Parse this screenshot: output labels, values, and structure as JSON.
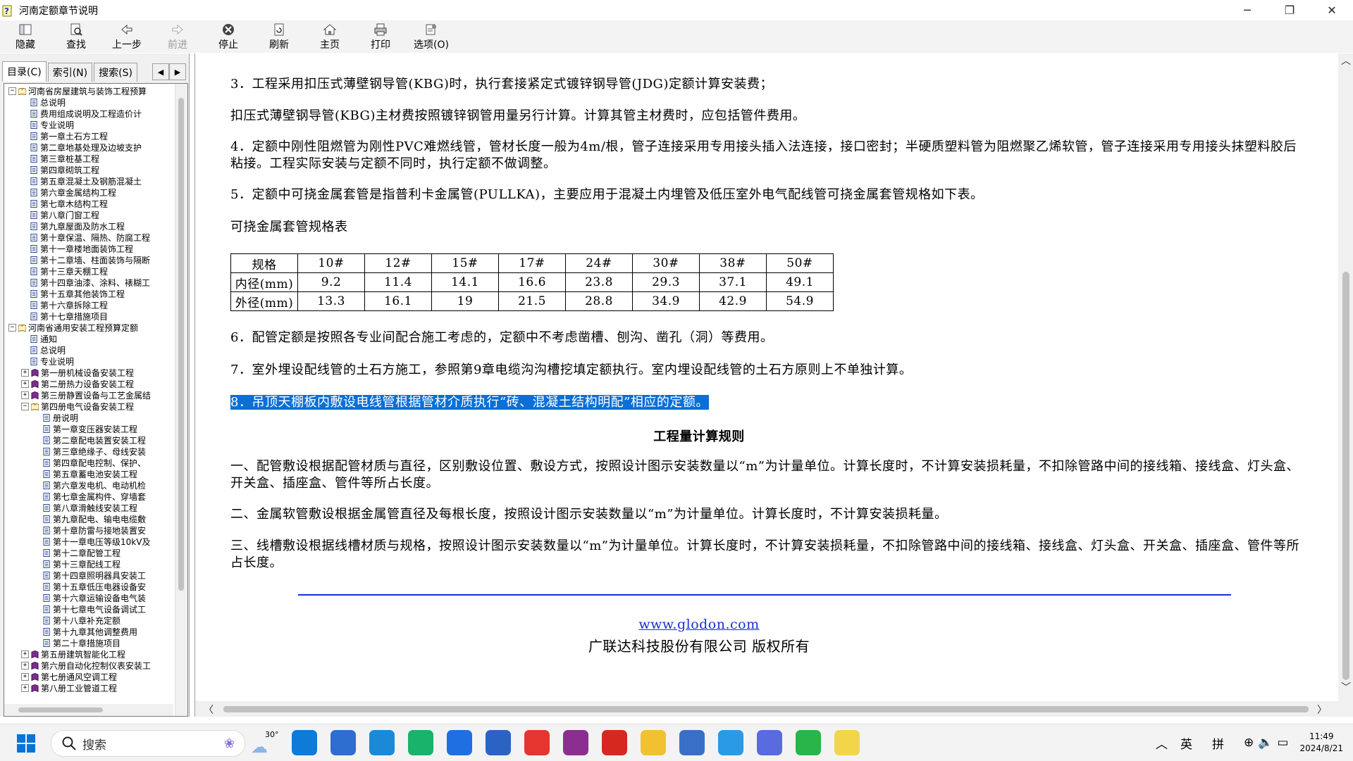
{
  "window": {
    "title": "河南定额章节说明",
    "min_label": "─",
    "max_label": "❐",
    "close_label": "✕"
  },
  "toolbar": [
    {
      "key": "hide",
      "label": "隐藏",
      "icon": "hide-icon",
      "enabled": true
    },
    {
      "key": "find",
      "label": "查找",
      "icon": "find-icon",
      "enabled": true
    },
    {
      "key": "back",
      "label": "上一步",
      "icon": "back-arrow-icon",
      "enabled": true
    },
    {
      "key": "forward",
      "label": "前进",
      "icon": "forward-arrow-icon",
      "enabled": false
    },
    {
      "key": "stop",
      "label": "停止",
      "icon": "stop-icon",
      "enabled": true
    },
    {
      "key": "refresh",
      "label": "刷新",
      "icon": "refresh-icon",
      "enabled": true
    },
    {
      "key": "home",
      "label": "主页",
      "icon": "home-icon",
      "enabled": true
    },
    {
      "key": "print",
      "label": "打印",
      "icon": "printer-icon",
      "enabled": true
    },
    {
      "key": "options",
      "label": "选项(O)",
      "icon": "options-icon",
      "enabled": true
    }
  ],
  "nav_tabs": [
    {
      "label": "目录(C)",
      "active": true
    },
    {
      "label": "索引(N)",
      "active": false
    },
    {
      "label": "搜索(S)",
      "active": false
    }
  ],
  "tree": [
    {
      "level": 0,
      "exp": "-",
      "type": "book-open",
      "label": "河南省房屋建筑与装饰工程预算"
    },
    {
      "level": 1,
      "type": "page",
      "label": "总说明"
    },
    {
      "level": 1,
      "type": "page",
      "label": "费用组成说明及工程造价计"
    },
    {
      "level": 1,
      "type": "page",
      "label": "专业说明"
    },
    {
      "level": 1,
      "type": "page",
      "label": "第一章土石方工程"
    },
    {
      "level": 1,
      "type": "page",
      "label": "第二章地基处理及边坡支护"
    },
    {
      "level": 1,
      "type": "page",
      "label": "第三章桩基工程"
    },
    {
      "level": 1,
      "type": "page",
      "label": "第四章砌筑工程"
    },
    {
      "level": 1,
      "type": "page",
      "label": "第五章混凝土及钢筋混凝土"
    },
    {
      "level": 1,
      "type": "page",
      "label": "第六章金属结构工程"
    },
    {
      "level": 1,
      "type": "page",
      "label": "第七章木结构工程"
    },
    {
      "level": 1,
      "type": "page",
      "label": "第八章门窗工程"
    },
    {
      "level": 1,
      "type": "page",
      "label": "第九章屋面及防水工程"
    },
    {
      "level": 1,
      "type": "page",
      "label": "第十章保温、隔热、防腐工程"
    },
    {
      "level": 1,
      "type": "page",
      "label": "第十一章楼地面装饰工程"
    },
    {
      "level": 1,
      "type": "page",
      "label": "第十二章墙、柱面装饰与隔断"
    },
    {
      "level": 1,
      "type": "page",
      "label": "第十三章天棚工程"
    },
    {
      "level": 1,
      "type": "page",
      "label": "第十四章油漆、涂料、裱糊工"
    },
    {
      "level": 1,
      "type": "page",
      "label": "第十五章其他装饰工程"
    },
    {
      "level": 1,
      "type": "page",
      "label": "第十六章拆除工程"
    },
    {
      "level": 1,
      "type": "page",
      "label": "第十七章措施项目"
    },
    {
      "level": 0,
      "exp": "-",
      "type": "book-open",
      "label": "河南省通用安装工程预算定额"
    },
    {
      "level": 1,
      "type": "page",
      "label": "通知"
    },
    {
      "level": 1,
      "type": "page",
      "label": "总说明"
    },
    {
      "level": 1,
      "type": "page",
      "label": "专业说明"
    },
    {
      "level": 1,
      "exp": "+",
      "type": "book",
      "label": "第一册机械设备安装工程"
    },
    {
      "level": 1,
      "exp": "+",
      "type": "book",
      "label": "第二册热力设备安装工程"
    },
    {
      "level": 1,
      "exp": "+",
      "type": "book",
      "label": "第三册静置设备与工艺金属结"
    },
    {
      "level": 1,
      "exp": "-",
      "type": "book-open",
      "label": "第四册电气设备安装工程"
    },
    {
      "level": 2,
      "type": "page",
      "label": "册说明"
    },
    {
      "level": 2,
      "type": "page",
      "label": "第一章变压器安装工程"
    },
    {
      "level": 2,
      "type": "page",
      "label": "第二章配电装置安装工程"
    },
    {
      "level": 2,
      "type": "page",
      "label": "第三章绝缘子、母线安装"
    },
    {
      "level": 2,
      "type": "page",
      "label": "第四章配电控制、保护、"
    },
    {
      "level": 2,
      "type": "page",
      "label": "第五章蓄电池安装工程"
    },
    {
      "level": 2,
      "type": "page",
      "label": "第六章发电机、电动机检"
    },
    {
      "level": 2,
      "type": "page",
      "label": "第七章金属构件、穿墙套"
    },
    {
      "level": 2,
      "type": "page",
      "label": "第八章滑触线安装工程"
    },
    {
      "level": 2,
      "type": "page",
      "label": "第九章配电、输电电缆敷"
    },
    {
      "level": 2,
      "type": "page",
      "label": "第十章防雷与接地装置安"
    },
    {
      "level": 2,
      "type": "page",
      "label": "第十一章电压等级10kV及"
    },
    {
      "level": 2,
      "type": "page",
      "label": "第十二章配管工程"
    },
    {
      "level": 2,
      "type": "page",
      "label": "第十三章配线工程"
    },
    {
      "level": 2,
      "type": "page",
      "label": "第十四章照明器具安装工"
    },
    {
      "level": 2,
      "type": "page",
      "label": "第十五章低压电器设备安"
    },
    {
      "level": 2,
      "type": "page",
      "label": "第十六章运输设备电气装"
    },
    {
      "level": 2,
      "type": "page",
      "label": "第十七章电气设备调试工"
    },
    {
      "level": 2,
      "type": "page",
      "label": "第十八章补充定额"
    },
    {
      "level": 2,
      "type": "page",
      "label": "第十九章其他调整费用"
    },
    {
      "level": 2,
      "type": "page",
      "label": "第二十章措施项目"
    },
    {
      "level": 1,
      "exp": "+",
      "type": "book",
      "label": "第五册建筑智能化工程"
    },
    {
      "level": 1,
      "exp": "+",
      "type": "book",
      "label": "第六册自动化控制仪表安装工"
    },
    {
      "level": 1,
      "exp": "+",
      "type": "book",
      "label": "第七册通风空调工程"
    },
    {
      "level": 1,
      "exp": "+",
      "type": "book",
      "label": "第八册工业管道工程"
    }
  ],
  "doc": {
    "p3": "3．工程采用扣压式薄壁钢导管(KBG)时，执行套接紧定式镀锌钢导管(JDG)定额计算安装费；",
    "p3b": "扣压式薄壁钢导管(KBG)主材费按照镀锌钢管用量另行计算。计算其管主材费时，应包括管件费用。",
    "p4": "4．定额中刚性阻燃管为刚性PVC难燃线管，管材长度一般为4m/根，管子连接采用专用接头插入法连接，接口密封；半硬质塑料管为阻燃聚乙烯软管，管子连接采用专用接头抹塑料胶后粘接。工程实际安装与定额不同时，执行定额不做调整。",
    "p5": "5．定额中可挠金属套管是指普利卡金属管(PULLKA)，主要应用于混凝土内埋管及低压室外电气配线管可挠金属套管规格如下表。",
    "table_title": "可挠金属套管规格表",
    "table": {
      "header": [
        "规格",
        "10#",
        "12#",
        "15#",
        "17#",
        "24#",
        "30#",
        "38#",
        "50#"
      ],
      "rows": [
        [
          "内径(mm)",
          "9.2",
          "11.4",
          "14.1",
          "16.6",
          "23.8",
          "29.3",
          "37.1",
          "49.1"
        ],
        [
          "外径(mm)",
          "13.3",
          "16.1",
          "19",
          "21.5",
          "28.8",
          "34.9",
          "42.9",
          "54.9"
        ]
      ]
    },
    "p6": "6．配管定额是按照各专业间配合施工考虑的，定额中不考虑凿槽、刨沟、凿孔（洞）等费用。",
    "p7": "7．室外埋设配线管的土石方施工，参照第9章电缆沟沟槽挖填定额执行。室内埋设配线管的土石方原则上不单独计算。",
    "p8": "8．吊顶天棚板内敷设电线管根据管材介质执行“砖、混凝土结构明配”相应的定额。",
    "heading": "工程量计算规则",
    "r1": "一、配管敷设根据配管材质与直径，区别敷设位置、敷设方式，按照设计图示安装数量以“m”为计量单位。计算长度时，不计算安装损耗量，不扣除管路中间的接线箱、接线盒、灯头盒、开关盒、插座盒、管件等所占长度。",
    "r2": "二、金属软管敷设根据金属管直径及每根长度，按照设计图示安装数量以“m”为计量单位。计算长度时，不计算安装损耗量。",
    "r3": "三、线槽敷设根据线槽材质与规格，按照设计图示安装数量以“m”为计量单位。计算长度时，不计算安装损耗量，不扣除管路中间的接线箱、接线盒、灯头盒、开关盒、插座盒、管件等所占长度。",
    "link": "www.glodon.com",
    "copyright": "广联达科技股份有限公司 版权所有"
  },
  "taskbar": {
    "search_placeholder": "搜索",
    "weather_temp": "30°",
    "apps": [
      "edge-icon",
      "mail-icon",
      "ie-icon",
      "wechat-work-icon",
      "feishu-icon",
      "store-icon",
      "calendar-icon",
      "winrar-icon",
      "wps-icon",
      "explorer-icon",
      "cad-icon",
      "browser-icon",
      "font-tool-icon",
      "wechat-icon",
      "help-icon"
    ],
    "ime_lang": "英",
    "ime_mode": "拼",
    "time": "11:49",
    "date": "2024/8/21"
  },
  "colors": {
    "highlight": "#0b6fd6",
    "link": "#1a2ed6",
    "rule": "#1a2ed6"
  }
}
